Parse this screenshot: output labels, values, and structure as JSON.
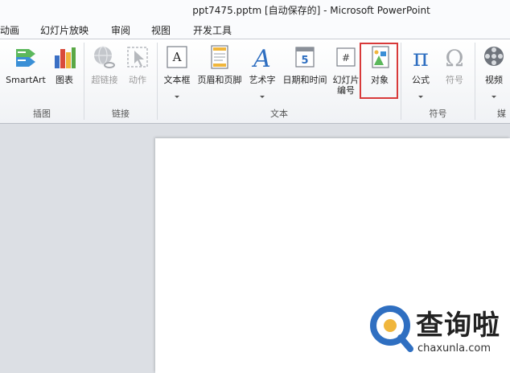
{
  "window": {
    "title": "ppt7475.pptm [自动保存的]  -  Microsoft PowerPoint"
  },
  "menu": {
    "items": [
      "动画",
      "幻灯片放映",
      "审阅",
      "视图",
      "开发工具"
    ]
  },
  "ribbon": {
    "groups": {
      "illustrations": "插图",
      "links": "链接",
      "text": "文本",
      "symbols": "符号",
      "media": "媒"
    },
    "buttons": {
      "smartart": "SmartArt",
      "chart": "图表",
      "hyperlink": "超链接",
      "action": "动作",
      "textbox": "文本框",
      "header_footer": "页眉和页脚",
      "wordart": "艺术字",
      "datetime": "日期和时间",
      "slide_number_line1": "幻灯片",
      "slide_number_line2": "编号",
      "object": "对象",
      "equation": "公式",
      "symbol": "符号",
      "video": "视频"
    },
    "icons": {
      "wordart_glyph": "A",
      "textbox_glyph": "A",
      "equation_glyph": "π",
      "symbol_glyph": "Ω",
      "slide_number_glyph": "#",
      "datetime_glyph": "5"
    }
  },
  "watermark": {
    "brand": "查询啦",
    "url": "chaxunla.com"
  },
  "colors": {
    "highlight": "#d83a3a",
    "accent_blue": "#2f6fc1"
  }
}
